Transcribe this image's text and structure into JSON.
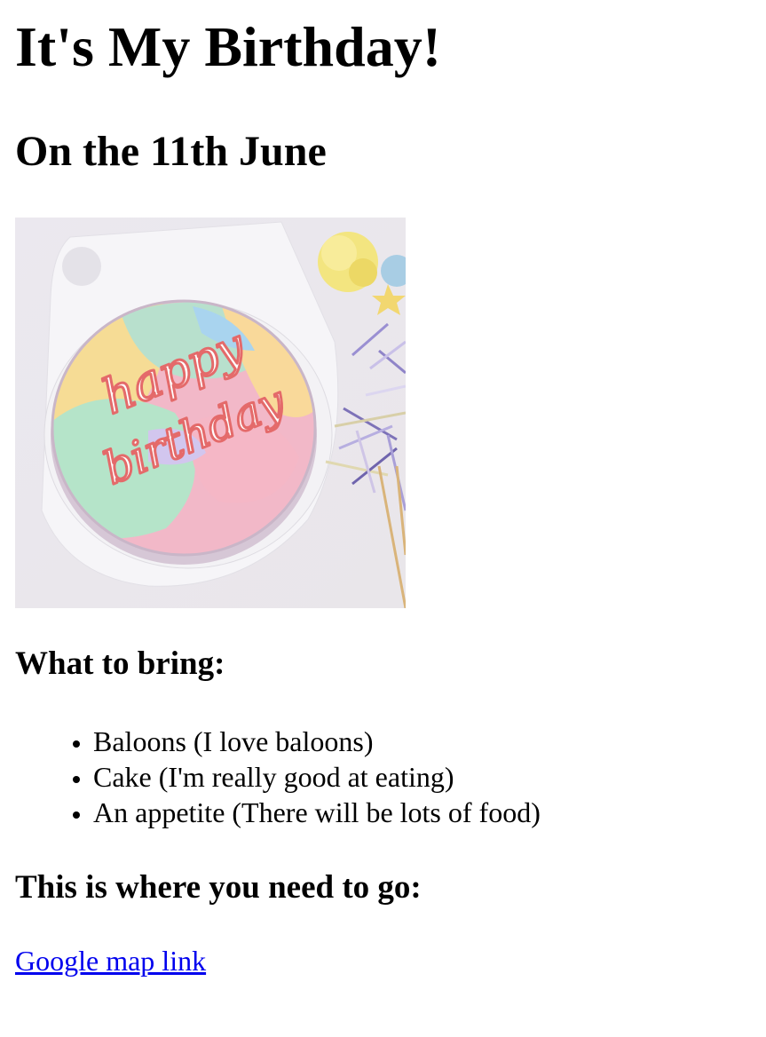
{
  "title": "It's My Birthday!",
  "date": "On the 11th June",
  "photo": {
    "alt": "happy birthday cake",
    "cake_text_line1": "happy",
    "cake_text_line2": "birthday"
  },
  "bring_heading": "What to bring:",
  "bring_items": [
    "Baloons (I love baloons)",
    "Cake (I'm really good at eating)",
    "An appetite (There will be lots of food)"
  ],
  "where_heading": "This is where you need to go:",
  "map_link": {
    "label": "Google map link"
  },
  "colors": {
    "link": "#0000ee",
    "text": "#000000",
    "background": "#ffffff"
  }
}
